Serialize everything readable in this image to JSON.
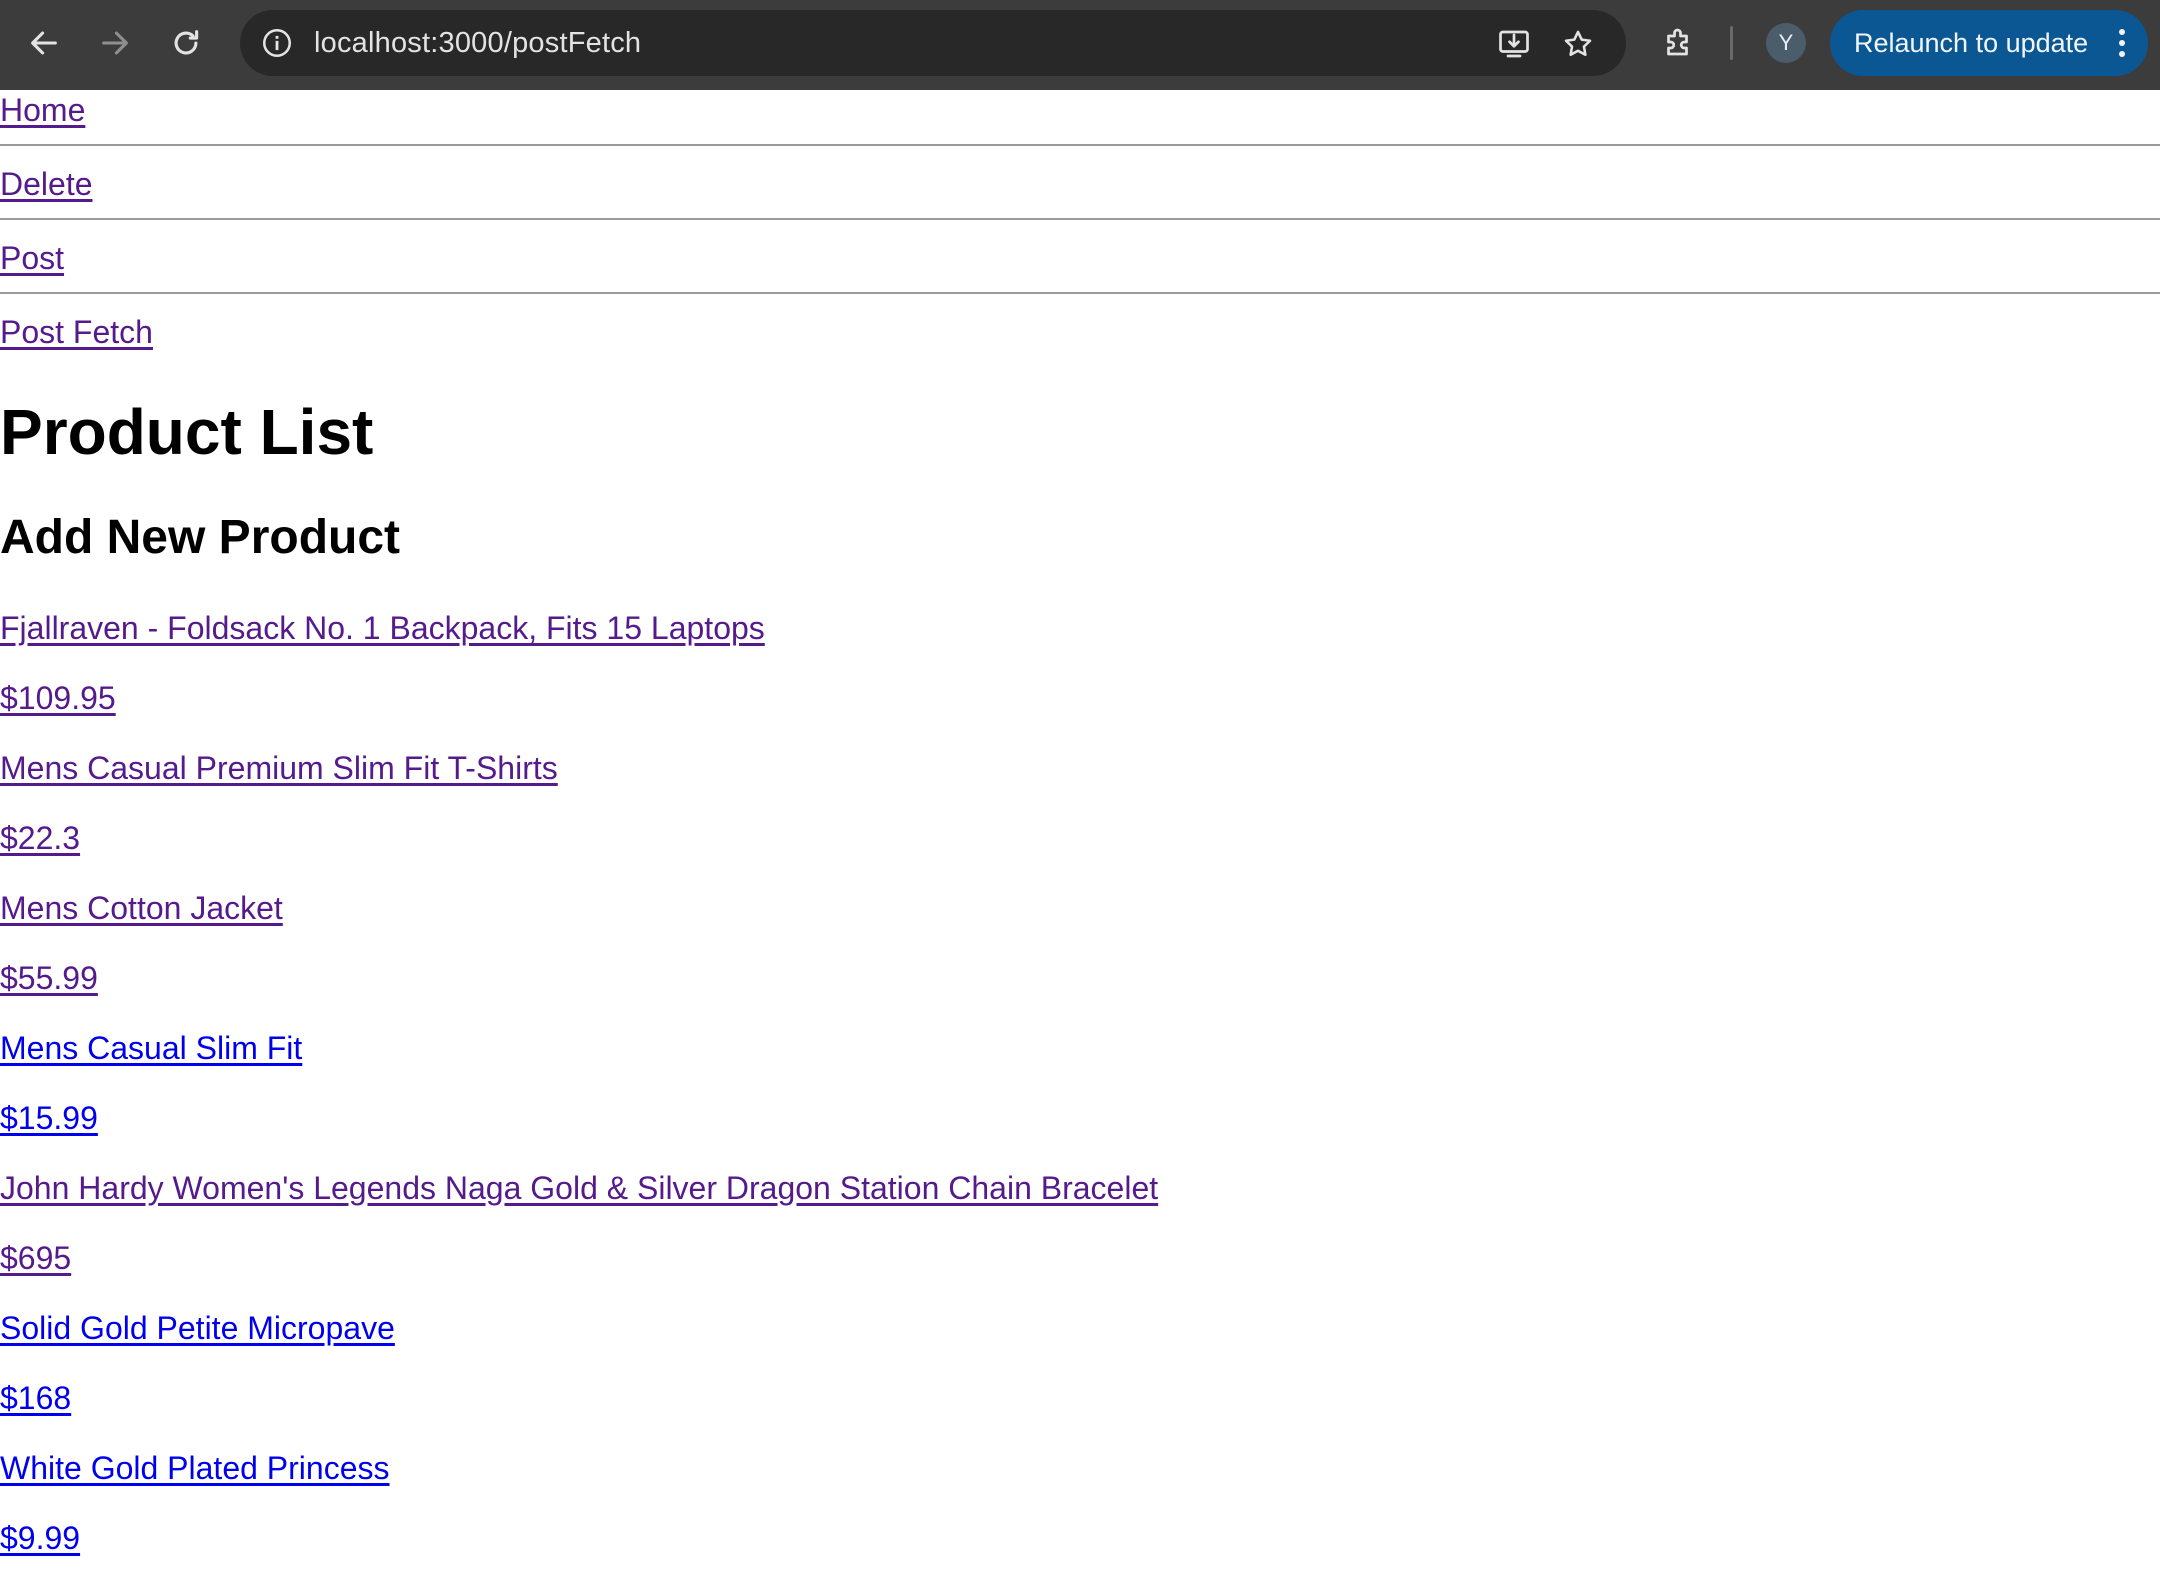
{
  "browser": {
    "url": "localhost:3000/postFetch",
    "profile_initial": "Y",
    "relaunch_label": "Relaunch to update",
    "icons": {
      "back": "arrow-left-icon",
      "forward": "arrow-right-icon",
      "reload": "reload-icon",
      "site_info": "info-icon",
      "install": "install-app-icon",
      "bookmark": "star-icon",
      "extensions": "puzzle-icon",
      "menu": "kebab-menu-icon"
    },
    "colors": {
      "toolbar": "#3c3c3c",
      "omnibox": "#282828",
      "relaunch": "#0b5794"
    }
  },
  "nav": {
    "links": [
      {
        "label": "Home",
        "visited": true
      },
      {
        "label": "Delete",
        "visited": true
      },
      {
        "label": "Post",
        "visited": true
      },
      {
        "label": "Post Fetch",
        "visited": true
      }
    ]
  },
  "page": {
    "title": "Product List",
    "subtitle": "Add New Product"
  },
  "products": [
    {
      "name": "Fjallraven - Foldsack No. 1 Backpack, Fits 15 Laptops",
      "price": "$109.95",
      "visited": true
    },
    {
      "name": "Mens Casual Premium Slim Fit T-Shirts",
      "price": "$22.3",
      "visited": true
    },
    {
      "name": "Mens Cotton Jacket",
      "price": "$55.99",
      "visited": true
    },
    {
      "name": "Mens Casual Slim Fit",
      "price": "$15.99",
      "visited": false
    },
    {
      "name": "John Hardy Women's Legends Naga Gold & Silver Dragon Station Chain Bracelet",
      "price": "$695",
      "visited": true
    },
    {
      "name": "Solid Gold Petite Micropave",
      "price": "$168",
      "visited": false
    },
    {
      "name": "White Gold Plated Princess",
      "price": "$9.99",
      "visited": false
    }
  ],
  "link_colors": {
    "visited": "#551a8b",
    "unvisited": "#0000ee"
  }
}
